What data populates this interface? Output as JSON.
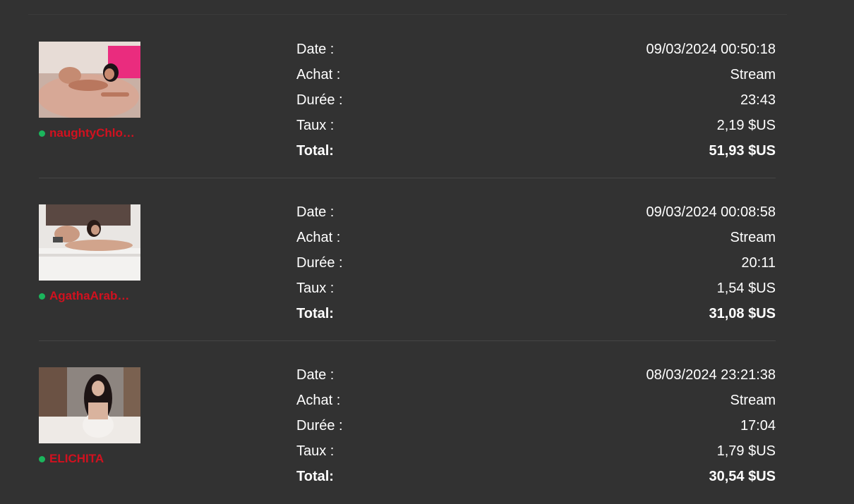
{
  "labels": {
    "date": "Date :",
    "purchase": "Achat :",
    "duration": "Durée :",
    "rate": "Taux :",
    "total": "Total:"
  },
  "colors": {
    "background": "#323232",
    "model_name": "#d1111f",
    "online": "#1bb55c"
  },
  "transactions": [
    {
      "model_name": "naughtyChlo…",
      "online": true,
      "thumbnail": "model-photo-1",
      "date": "09/03/2024 00:50:18",
      "purchase": "Stream",
      "duration": "23:43",
      "rate": "2,19 $US",
      "total": "51,93 $US"
    },
    {
      "model_name": "AgathaArab…",
      "online": true,
      "thumbnail": "model-photo-2",
      "date": "09/03/2024 00:08:58",
      "purchase": "Stream",
      "duration": "20:11",
      "rate": "1,54 $US",
      "total": "31,08 $US"
    },
    {
      "model_name": "ELICHITA",
      "online": true,
      "thumbnail": "model-photo-3",
      "date": "08/03/2024 23:21:38",
      "purchase": "Stream",
      "duration": "17:04",
      "rate": "1,79 $US",
      "total": "30,54 $US"
    }
  ]
}
